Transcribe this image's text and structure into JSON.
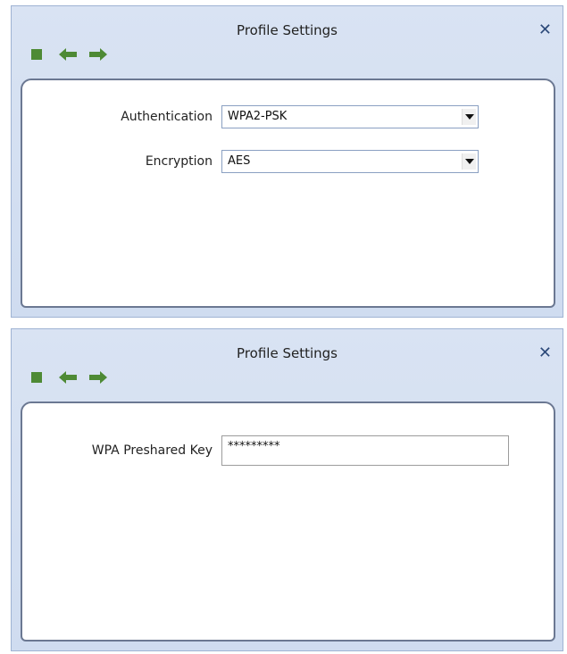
{
  "panels": [
    {
      "title": "Profile Settings",
      "fields": [
        {
          "label": "Authentication",
          "value": "WPA2-PSK"
        },
        {
          "label": "Encryption",
          "value": "AES"
        }
      ]
    },
    {
      "title": "Profile Settings",
      "fields": [
        {
          "label": "WPA Preshared Key",
          "value": "*********"
        }
      ]
    }
  ],
  "icons": {
    "close": "close-icon",
    "stop": "stop-icon",
    "back": "arrow-left-icon",
    "forward": "arrow-right-icon",
    "dropdown": "chevron-down-icon"
  },
  "colors": {
    "toolbar_icon": "#4e8a35",
    "panel_bg": "#d9e3f3",
    "panel_border": "#6b7892"
  }
}
